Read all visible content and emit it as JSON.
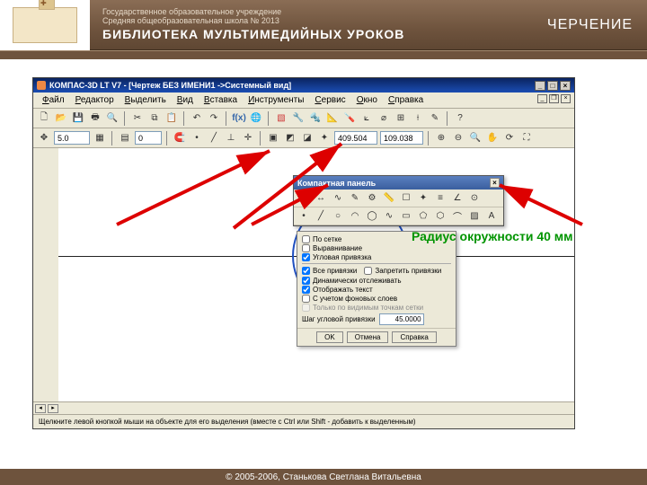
{
  "banner": {
    "org_line1": "Государственное образовательное учреждение",
    "org_line2": "Средняя общеобразовательная школа № 2013",
    "library": "БИБЛИОТЕКА МУЛЬТИМЕДИЙНЫХ УРОКОВ",
    "subject": "ЧЕРЧЕНИЕ"
  },
  "app": {
    "title": "КОМПАС-3D LT V7 - [Чертеж БЕЗ ИМЕНИ1 ->Системный вид]",
    "menus": [
      "Файл",
      "Редактор",
      "Выделить",
      "Вид",
      "Вставка",
      "Инструменты",
      "Сервис",
      "Окно",
      "Справка"
    ],
    "toolbar2": {
      "value1": "5.0",
      "value2": "0",
      "coord_x": "409.504",
      "coord_y": "109.038"
    },
    "compact_title": "Компактная панель",
    "dialog": {
      "opt_grid": "По сетке",
      "opt_align": "Выравнивание",
      "opt_angle": "Угловая привязка",
      "opt_all": "Все привязки",
      "opt_forbid": "Запретить привязки",
      "opt_dyn": "Динамически отслеживать",
      "opt_text": "Отображать текст",
      "opt_bg": "С учетом фоновых слоев",
      "opt_grid_only": "Только по видимым точкам сетки",
      "step_label": "Шаг угловой привязки",
      "step_value": "45.0000",
      "btn_ok": "OK",
      "btn_cancel": "Отмена",
      "btn_help": "Справка"
    },
    "status": "Щелкните левой кнопкой мыши на объекте для его выделения (вместе с Ctrl или Shift - добавить к выделенным)"
  },
  "annotation": {
    "radius": "Радиус окружности 40 мм"
  },
  "footer": "© 2005-2006, Станькова Светлана Витальевна"
}
